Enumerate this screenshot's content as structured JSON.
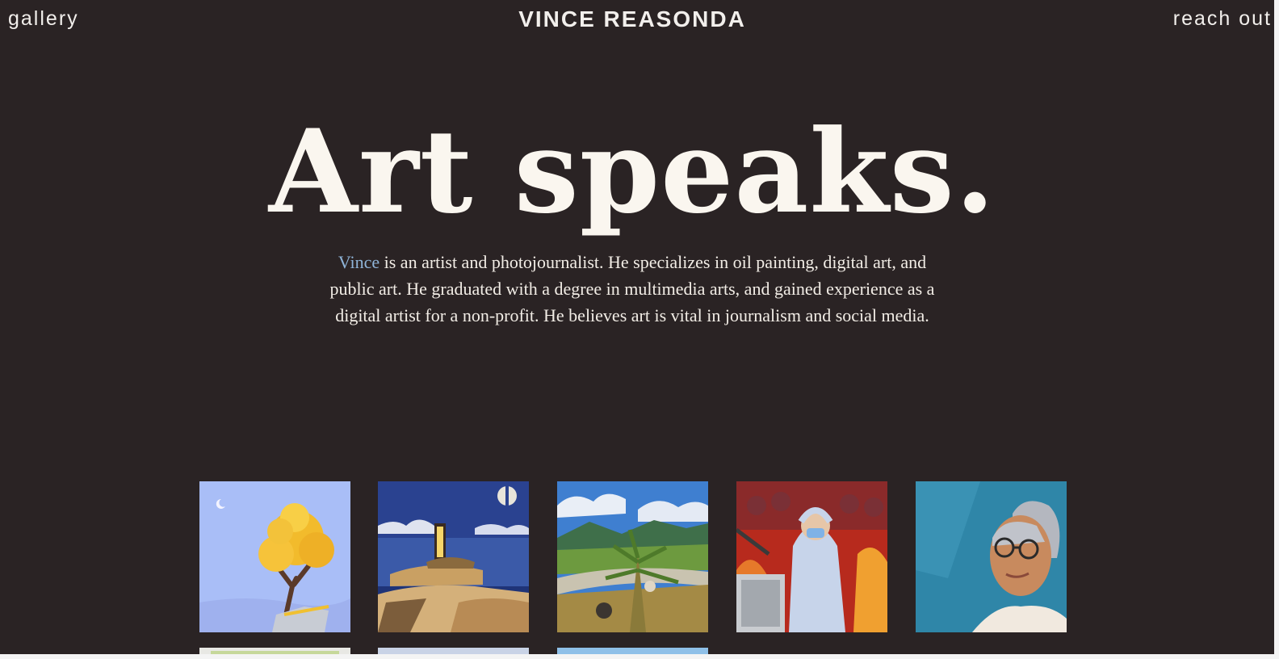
{
  "nav": {
    "gallery_label": "gallery",
    "brand": "VINCE REASONDA",
    "contact_label": "reach out"
  },
  "hero": {
    "title": "Art speaks.",
    "bio_name": "Vince",
    "bio_text": " is an artist and photojournalist. He specializes in oil painting, digital art, and public art. He graduated with a degree in multimedia arts, and gained experience as a digital artist for a non-profit. He believes art is vital in journalism and social media."
  },
  "gallery": {
    "artworks": [
      {
        "subject": "golden tree on rock under moon"
      },
      {
        "subject": "surreal doorway on shore at night"
      },
      {
        "subject": "landscape with palm leaves and river"
      },
      {
        "subject": "health worker in protective suit"
      },
      {
        "subject": "portrait of elderly woman with glasses"
      }
    ]
  },
  "colors": {
    "background": "#2a2324",
    "text": "#f2efec",
    "accent_link": "#8fb4d8"
  }
}
